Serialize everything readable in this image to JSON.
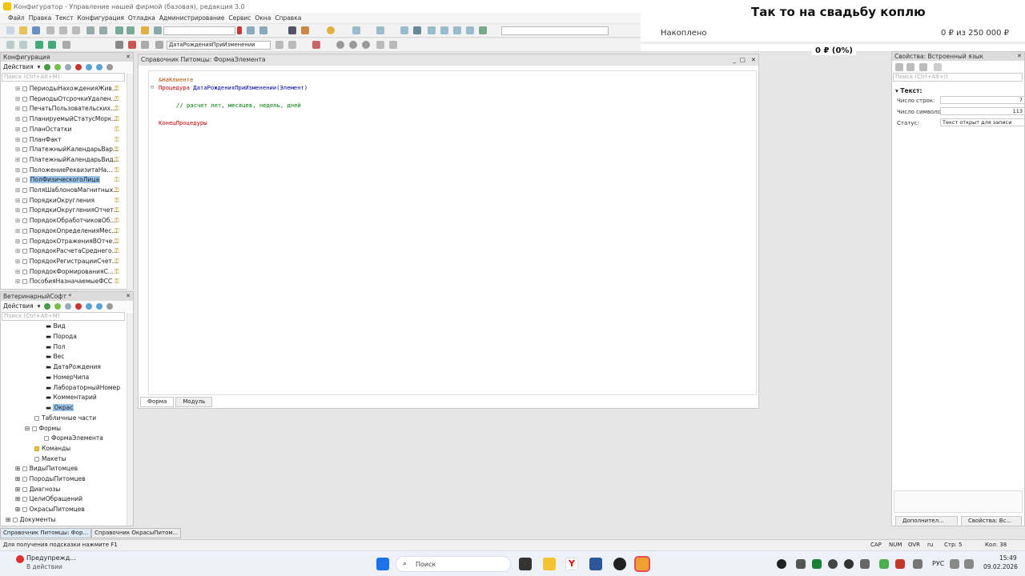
{
  "window": {
    "title": "Конфигуратор - Управление нашей фирмой (базовая), редакция 3.0"
  },
  "menu": [
    "Файл",
    "Правка",
    "Текст",
    "Конфигурация",
    "Отладка",
    "Администрирование",
    "Сервис",
    "Окна",
    "Справка"
  ],
  "toolbar": {
    "procedure_combo": "ДатаРожденияПриИзменении"
  },
  "banner": {
    "title": "Так то на свадьбу коплю",
    "accumulated_label": "Накоплено",
    "goal_text": "0 ₽ из 250 000 ₽",
    "progress_text": "0 ₽ (0%)",
    "progress": 0
  },
  "config_panel": {
    "title": "Конфигурация",
    "actions_label": "Действия",
    "search_placeholder": "Поиск (Ctrl+Alt+M)",
    "items": [
      "ПериодыНахожденияЖив...",
      "ПериодыОтсрочкиУдален...",
      "ПечатьПользовательских...",
      "ПланируемыйСтатусМорк...",
      "ПланОстатки",
      "ПланФакт",
      "ПлатежныйКалендарьВар...",
      "ПлатежныйКалендарьВид...",
      "ПоложениеРеквизитаНа...",
      "ПолФизическогоЛица",
      "ПоляШаблоновМагнитных...",
      "ПорядкиОкругления",
      "ПорядкиОкругленияОтчет...",
      "ПорядокОбработчиковОб...",
      "ПорядокОпределенияМес...",
      "ПорядокОтраженияВОтче...",
      "ПорядокРасчетаСреднего...",
      "ПорядокРегистрацииСчет...",
      "ПорядокФормированияС...",
      "ПособияНазначаемыеФСС"
    ],
    "selected_index": 9
  },
  "vet_panel": {
    "title": "ВетеринарныйСофт *",
    "actions_label": "Действия",
    "search_placeholder": "Поиск (Ctrl+Alt+M)",
    "attributes": [
      "Вид",
      "Порода",
      "Пол",
      "Вес",
      "ДатаРождения",
      "НомерЧипа",
      "ЛабораторныйНомер",
      "Комментарий",
      "Окрас"
    ],
    "selected_attr": "Окрас",
    "tabular": "Табличные части",
    "forms": "Формы",
    "form_item": "ФормаЭлемента",
    "commands": "Команды",
    "layouts": "Макеты",
    "catalogs": [
      "ВидыПитомцев",
      "ПородыПитомцев",
      "Диагнозы",
      "ЦелиОбращений",
      "ОкрасыПитомцев"
    ],
    "documents": "Документы"
  },
  "editor": {
    "title": "Справочник Питомцы: ФормаЭлемента",
    "lines": {
      "directive": "&НаКлиенте",
      "proc_kw": "Процедура",
      "proc_sig": "ДатаРожденияПриИзменении(Элемент)",
      "comment": "// расчет лет, месяцев, недель, дней",
      "end": "КонецПроцедуры"
    },
    "tabs": [
      "Форма",
      "Модуль"
    ]
  },
  "props": {
    "title": "Свойства: Встроенный язык",
    "search_placeholder": "Поиск (Ctrl+Alt+I)",
    "group": "Текст:",
    "rows": [
      {
        "label": "Число строк:",
        "value": "7"
      },
      {
        "label": "Число символов:",
        "value": "113"
      },
      {
        "label": "Статус:",
        "value": "Текст открыт для записи"
      }
    ],
    "bottom_tabs": [
      "Дополнител...",
      "Свойства: Вс..."
    ]
  },
  "window_tabs": [
    "Справочник Питомцы: Фор...",
    "Справочник ОкрасыПитом..."
  ],
  "status": {
    "hint": "Для получения подсказки нажмите F1",
    "cap": "CAP",
    "num": "NUM",
    "ovr": "OVR",
    "lang": "ru",
    "line": "Стр: 5",
    "col": "Кол: 38"
  },
  "taskbar": {
    "notif_title": "Предупрежд...",
    "notif_sub": "В действии",
    "search": "Поиск",
    "lang": "РУС",
    "time": "15:49",
    "date": "09.02.2026"
  }
}
